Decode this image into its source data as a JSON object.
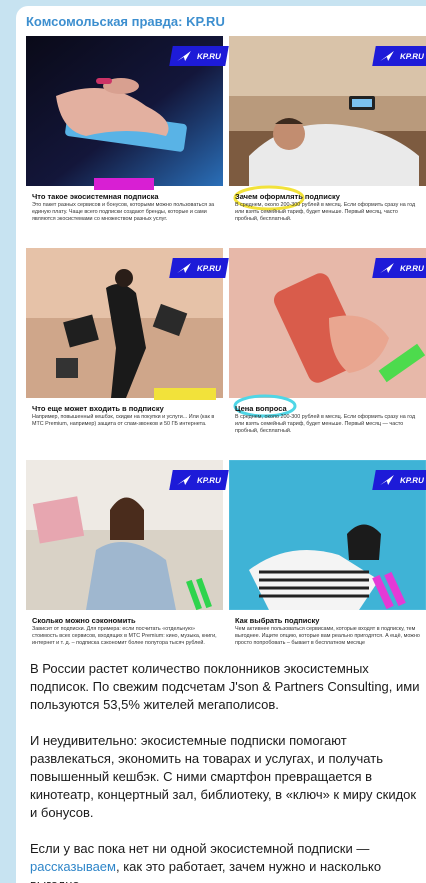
{
  "post": {
    "channel_title": "Комсомольская правда: KP.RU",
    "brand_logo_text": "KP.RU",
    "cards": [
      {
        "title": "Что такое экосистемная подписка",
        "text": "Это пакет разных сервисов и бонусов, которыми можно пользоваться за единую плату. Чаще всего подписки создают бренды, которые и сами являются экосистемами со множеством разных услуг."
      },
      {
        "title": "Зачем оформлять подписку",
        "text": "В среднем, около 200-300 рублей в месяц. Если оформить сразу на год или взять семейный тариф, будет меньше. Первый месяц, часто пробный, бесплатный."
      },
      {
        "title": "Что еще может входить в подписку",
        "text": "Например, повышенный кешбэк, скидки на покупки и услуги... Или (как в МТС Premium, например) защита от спам-звонков и 50 ГБ интернета."
      },
      {
        "title": "Цена вопроса",
        "text": "В среднем, около 200-300 рублей в месяц. Если оформить сразу на год или взять семейный тариф, будет меньше. Первый месяц — часто пробный, бесплатный."
      },
      {
        "title": "Сколько можно сэкономить",
        "text": "Зависит от подписки. Для примера: если посчитать «отдельную» стоимость всех сервисов, входящих в МТС Premium: кино, музыка, книги, интернет и т. д. – подписка сэкономит более полутора тысяч рублей."
      },
      {
        "title": "Как выбрать подписку",
        "text": "Чем активнее пользоваться сервисами, которые входят в подписку, тем выгоднее. Ищите опцию, которые вам реально пригодятся. А ещё, можно просто попробовать – бывает в бесплатном месяце"
      }
    ],
    "paragraphs": [
      "В России растет количество поклонников экосистемных подписок. По свежим подсчетам J'son & Partners Consulting, ими пользуются 53,5% жителей мегаполисов.",
      "И неудивительно: экосистемные подписки помогают развлекаться, экономить на товарах и услугах, и получать повышенный кешбэк. С ними смартфон превращается в кинотеатр, концертный зал, библиотеку, в «ключ» к миру скидок и бонусов."
    ],
    "last_paragraph": {
      "before": "Если у вас пока нет ни одной экосистемной подписки —",
      "link": "рассказываем",
      "after": ", как это работает, зачем нужно и насколько выгодно"
    },
    "colors": {
      "channel": "#3d8fcf",
      "brand_blue": "#1d1bd8",
      "link": "#2f86c9"
    }
  }
}
